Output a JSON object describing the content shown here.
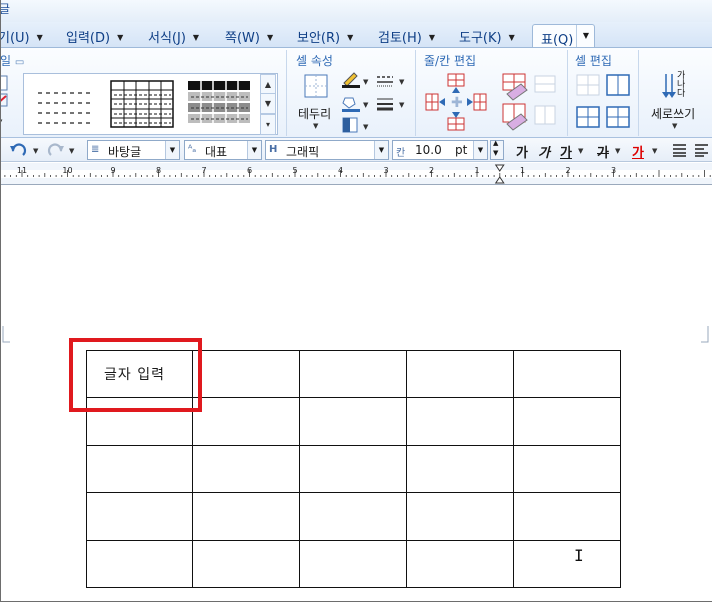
{
  "title": {
    "fragment": "글"
  },
  "menu": {
    "items": [
      {
        "label": "기(U)",
        "name": "menu-view"
      },
      {
        "label": "입력(D)",
        "name": "menu-insert"
      },
      {
        "label": "서식(J)",
        "name": "menu-format"
      },
      {
        "label": "쪽(W)",
        "name": "menu-page"
      },
      {
        "label": "보안(R)",
        "name": "menu-security"
      },
      {
        "label": "검토(H)",
        "name": "menu-review"
      },
      {
        "label": "도구(K)",
        "name": "menu-tools"
      }
    ],
    "active_tab": "표(Q)"
  },
  "ribbon": {
    "groups": {
      "table_style": "일",
      "cell_props": "셀 속성",
      "row_col_edit": "줄/칸 편집",
      "cell_edit": "셀 편집"
    },
    "border_label": "테두리",
    "vertical_text_label": "세로쓰기",
    "vertical_text_glyphs": "가나다"
  },
  "toolbar": {
    "style_value": "바탕글",
    "lang_value": "대표",
    "font_value": "그래픽",
    "size_value": "10.0",
    "size_unit": "pt",
    "bold": "가",
    "italic": "가",
    "underline": "가",
    "strike": "가",
    "color": "가"
  },
  "ruler": {
    "labels": [
      "11",
      "10",
      "9",
      "8",
      "7",
      "6",
      "5",
      "4",
      "3",
      "2",
      "1",
      "1",
      "2",
      "3"
    ]
  },
  "document": {
    "cell_text": "글자 입력",
    "rows": 5,
    "cols": 5
  },
  "colors": {
    "accent": "#2f6ab5",
    "menu_text": "#0f3f86",
    "highlight": "#e0191e"
  }
}
